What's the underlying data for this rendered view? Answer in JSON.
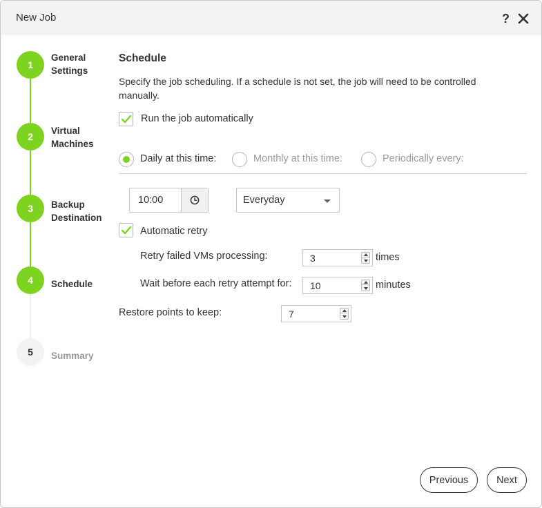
{
  "window": {
    "title": "New Job",
    "help": "?"
  },
  "steps": [
    {
      "number": "1",
      "label": "General Settings",
      "state": "complete"
    },
    {
      "number": "2",
      "label": "Virtual Machines",
      "state": "complete"
    },
    {
      "number": "3",
      "label": "Backup Destination",
      "state": "complete"
    },
    {
      "number": "4",
      "label": "Schedule",
      "state": "current"
    },
    {
      "number": "5",
      "label": "Summary",
      "state": "pending"
    }
  ],
  "schedule": {
    "title": "Schedule",
    "description": "Specify the job scheduling. If a schedule is not set, the job will need to be controlled manually.",
    "run_auto": {
      "label": "Run the job automatically",
      "checked": true
    },
    "options": [
      {
        "label": "Daily at this time:",
        "selected": true
      },
      {
        "label": "Monthly at this time:",
        "selected": false
      },
      {
        "label": "Periodically every:",
        "selected": false
      }
    ],
    "time": "10:00",
    "frequency": "Everyday",
    "auto_retry": {
      "label": "Automatic retry",
      "checked": true
    },
    "retry_count": {
      "label": "Retry failed VMs processing:",
      "value": "3",
      "unit": "times"
    },
    "retry_wait": {
      "label": "Wait before each retry attempt for:",
      "value": "10",
      "unit": "minutes"
    },
    "restore_points": {
      "label": "Restore points to keep:",
      "value": "7"
    }
  },
  "footer": {
    "previous": "Previous",
    "next": "Next"
  },
  "colors": {
    "accent": "#7ed321",
    "titlebar": "#f3f3f3"
  }
}
